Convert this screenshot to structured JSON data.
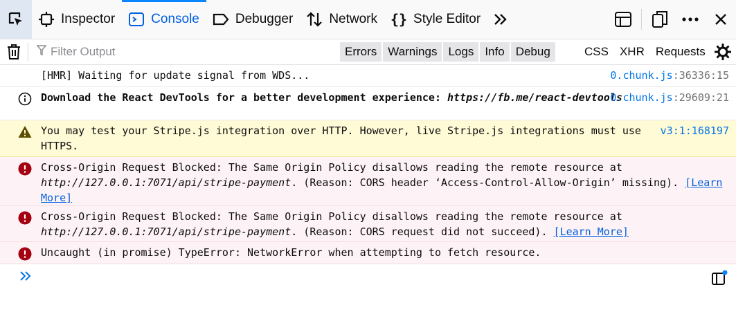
{
  "tabs": [
    {
      "label": "Inspector",
      "icon": "inspector-icon"
    },
    {
      "label": "Console",
      "icon": "console-icon"
    },
    {
      "label": "Debugger",
      "icon": "debugger-icon"
    },
    {
      "label": "Network",
      "icon": "network-icon"
    },
    {
      "label": "Style Editor",
      "icon": "style-editor-icon"
    }
  ],
  "filter": {
    "placeholder": "Filter Output"
  },
  "levels": [
    "Errors",
    "Warnings",
    "Logs",
    "Info",
    "Debug"
  ],
  "types": [
    "CSS",
    "XHR",
    "Requests"
  ],
  "messages": [
    {
      "kind": "log",
      "text": "[HMR] Waiting for update signal from WDS...",
      "loc_file": "0.chunk.js",
      "loc_pos": ":36336:15"
    },
    {
      "kind": "info",
      "text_bold": "Download the React DevTools for a better development experience: ",
      "text_link": "https://fb.me/react-devtools",
      "loc_file": "0.chunk.js",
      "loc_pos": ":29609:21"
    },
    {
      "kind": "warning",
      "text": "You may test your Stripe.js integration over HTTP. However, live Stripe.js integrations must use HTTPS.",
      "loc_file": "v3:1:168197",
      "loc_pos": ""
    },
    {
      "kind": "error",
      "text1": "Cross-Origin Request Blocked: The Same Origin Policy disallows reading the remote resource at ",
      "url": "http://127.0.0.1:7071/api/stripe-payment",
      "text2": ". (Reason: CORS header ‘Access-Control-Allow-Origin’ missing). ",
      "learn": "[Learn More]"
    },
    {
      "kind": "error",
      "text1": "Cross-Origin Request Blocked: The Same Origin Policy disallows reading the remote resource at ",
      "url": "http://127.0.0.1:7071/api/stripe-payment",
      "text2": ". (Reason: CORS request did not succeed). ",
      "learn": "[Learn More]"
    },
    {
      "kind": "error",
      "text": "Uncaught (in promise) TypeError: NetworkError when attempting to fetch resource."
    }
  ],
  "colors": {
    "accent": "#0a84ff",
    "error_bg": "#fdf2f5",
    "warning_bg": "#fffbd6",
    "error_icon": "#a4000f",
    "warning_icon": "#5a4d00"
  }
}
